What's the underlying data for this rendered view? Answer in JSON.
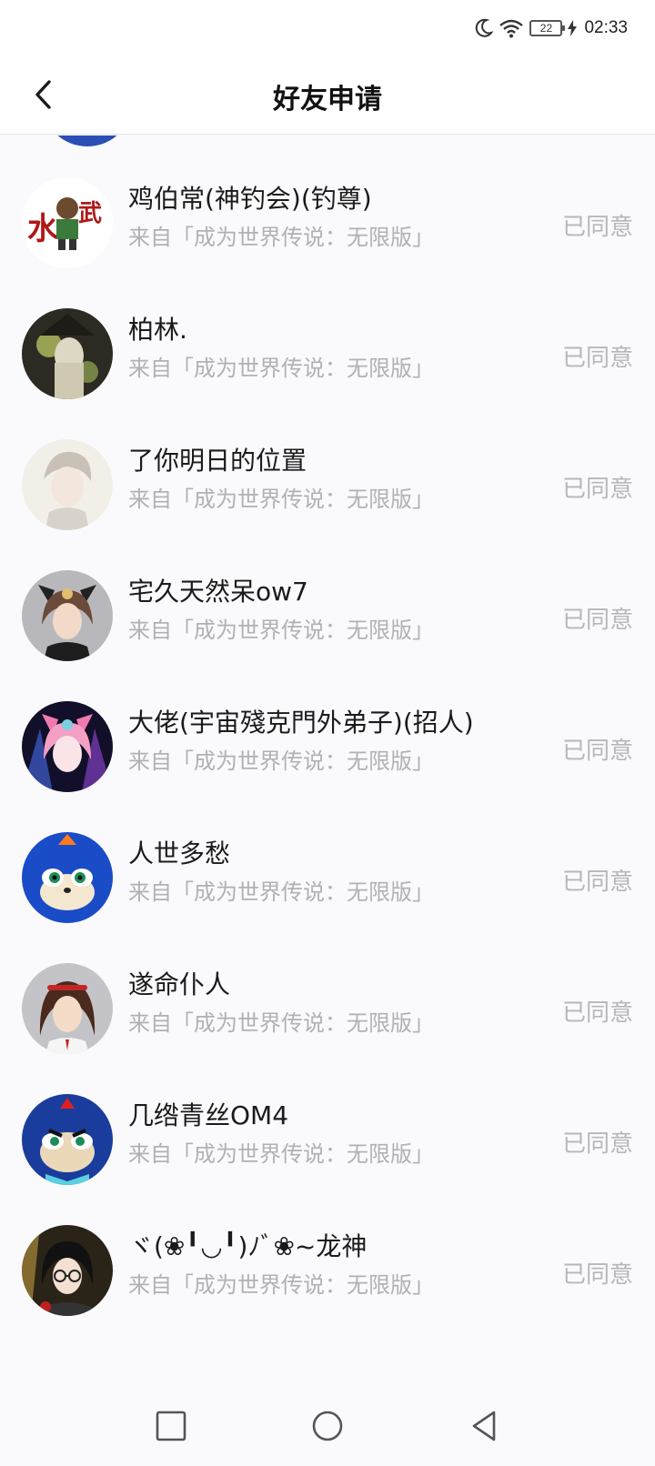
{
  "status_bar": {
    "battery_level": "22",
    "time": "02:33",
    "icons": [
      "moon-icon",
      "wifi-icon",
      "battery-icon",
      "charging-icon"
    ]
  },
  "header": {
    "title": "好友申请",
    "back_icon": "chevron-left-icon"
  },
  "requests": [
    {
      "name": "鸡伯常(神钓会)(钓尊)",
      "source": "来自「成为世界传说：无限版」",
      "status": "已同意"
    },
    {
      "name": "柏林.",
      "source": "来自「成为世界传说：无限版」",
      "status": "已同意"
    },
    {
      "name": "了你明日的位置",
      "source": "来自「成为世界传说：无限版」",
      "status": "已同意"
    },
    {
      "name": "宅久天然呆ow7",
      "source": "来自「成为世界传说：无限版」",
      "status": "已同意"
    },
    {
      "name": "大佬(宇宙殘克門外弟子)(招人)",
      "source": "来自「成为世界传说：无限版」",
      "status": "已同意"
    },
    {
      "name": "人世多愁",
      "source": "来自「成为世界传说：无限版」",
      "status": "已同意"
    },
    {
      "name": "遂命仆人",
      "source": "来自「成为世界传说：无限版」",
      "status": "已同意"
    },
    {
      "name": "几绺青丝OM4",
      "source": "来自「成为世界传说：无限版」",
      "status": "已同意"
    },
    {
      "name": "ヾ(❀╹◡╹)ﾉﾞ❀~龙神",
      "source": "来自「成为世界传说：无限版」",
      "status": "已同意"
    }
  ],
  "nav_bar": {
    "icons": [
      "recent-apps-icon",
      "home-icon",
      "back-triangle-icon"
    ]
  }
}
